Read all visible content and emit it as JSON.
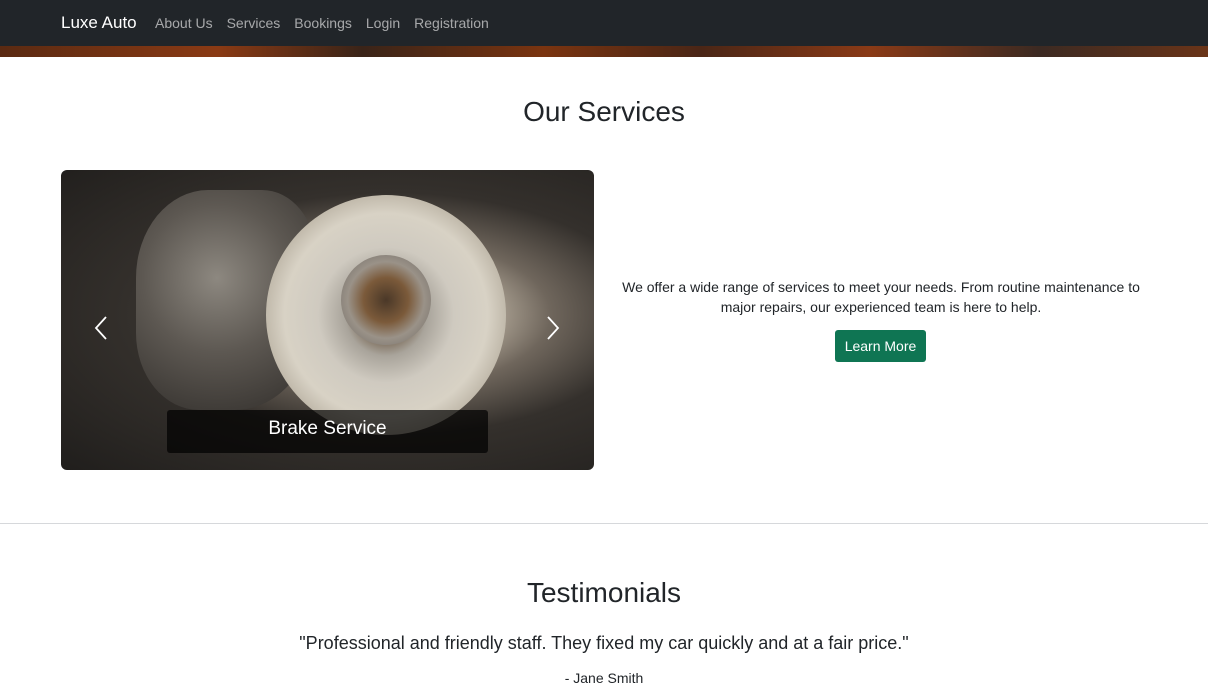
{
  "navbar": {
    "brand": "Luxe Auto",
    "links": [
      "About Us",
      "Services",
      "Bookings",
      "Login",
      "Registration"
    ]
  },
  "services": {
    "title": "Our Services",
    "carousel": {
      "caption": "Brake Service",
      "prev_icon": "chevron-left-icon",
      "next_icon": "chevron-right-icon"
    },
    "description": "We offer a wide range of services to meet your needs. From routine maintenance to major repairs, our experienced team is here to help.",
    "button_label": "Learn More",
    "button_color": "#0f7553"
  },
  "testimonials": {
    "title": "Testimonials",
    "quote": "\"Professional and friendly staff. They fixed my car quickly and at a fair price.\"",
    "author": "- Jane Smith"
  }
}
